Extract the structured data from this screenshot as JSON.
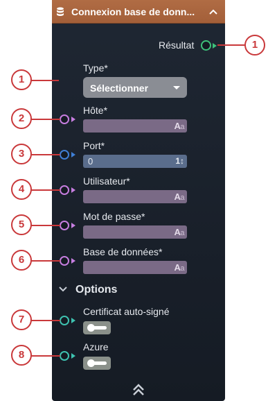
{
  "node": {
    "title": "Connexion base de donn...",
    "header_color": "#b06c44",
    "output": {
      "label": "Résultat",
      "port_color": "#3ec27a"
    },
    "type_field": {
      "label": "Type*",
      "placeholder": "Sélectionner"
    },
    "fields": [
      {
        "label": "Hôte*",
        "kind": "text",
        "value": "",
        "port_color": "#c77ee0"
      },
      {
        "label": "Port*",
        "kind": "number",
        "value": "0",
        "port_color": "#3f7fd6"
      },
      {
        "label": "Utilisateur*",
        "kind": "text",
        "value": "",
        "port_color": "#c77ee0"
      },
      {
        "label": "Mot de passe*",
        "kind": "text",
        "value": "",
        "port_color": "#c77ee0"
      },
      {
        "label": "Base de données*",
        "kind": "text",
        "value": "",
        "port_color": "#c77ee0"
      }
    ],
    "options_section": {
      "title": "Options",
      "toggles": [
        {
          "label": "Certificat auto-signé",
          "enabled": false,
          "port_color": "#3ec2b0"
        },
        {
          "label": "Azure",
          "enabled": false,
          "port_color": "#3ec2b0"
        }
      ]
    },
    "text_type_icon": {
      "big": "A",
      "small": "a"
    },
    "number_type_icon": "1↕"
  },
  "callouts": [
    "1",
    "1",
    "2",
    "3",
    "4",
    "5",
    "6",
    "7",
    "8"
  ],
  "colors": {
    "callout": "#c9383a",
    "panel_bg": "#1f2733"
  }
}
